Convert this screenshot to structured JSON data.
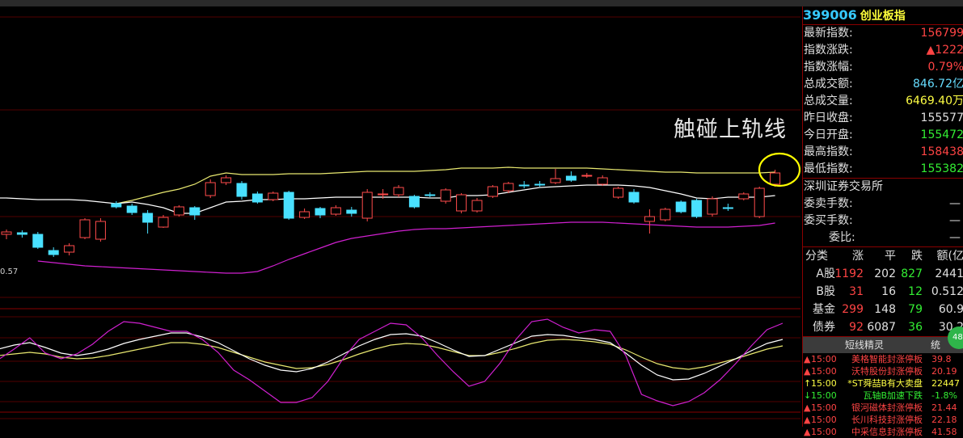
{
  "annotation": "触碰上轨线",
  "y_axis_label": "0.57",
  "stock": {
    "code": "399006",
    "name": "创业板指"
  },
  "quote_rows": [
    {
      "label": "最新指数:",
      "value": "156799",
      "color": "#ff4444"
    },
    {
      "label": "指数涨跌:",
      "value": "▲1222",
      "color": "#ff4444"
    },
    {
      "label": "指数涨幅:",
      "value": "0.79%",
      "color": "#ff4444"
    },
    {
      "label": "总成交额:",
      "value": "846.72亿",
      "color": "#66ddff"
    },
    {
      "label": "总成交量:",
      "value": "6469.40万",
      "color": "#ffff44"
    },
    {
      "label": "昨日收盘:",
      "value": "155577",
      "color": "#e0e0e0"
    },
    {
      "label": "今日开盘:",
      "value": "155472",
      "color": "#33ee33"
    },
    {
      "label": "最高指数:",
      "value": "158438",
      "color": "#ff4444"
    },
    {
      "label": "最低指数:",
      "value": "155382",
      "color": "#33ee33"
    }
  ],
  "exchange": "深圳证券交易所",
  "order_rows": [
    {
      "label": "委卖手数:",
      "value": "—"
    },
    {
      "label": "委买手数:",
      "value": "—"
    },
    {
      "label": "委比:",
      "value": "—"
    }
  ],
  "breadth": {
    "headers": [
      "分类",
      "涨",
      "平",
      "跌",
      "额(亿"
    ],
    "rows": [
      {
        "cat": "A股",
        "up": "1192",
        "flat": "202",
        "down": "827",
        "amt": "2441"
      },
      {
        "cat": "B股",
        "up": "31",
        "flat": "16",
        "down": "12",
        "amt": "0.512"
      },
      {
        "cat": "基金",
        "up": "299",
        "flat": "148",
        "down": "79",
        "amt": "60.9"
      },
      {
        "cat": "债券",
        "up": "92",
        "flat": "6087",
        "down": "36",
        "amt": "30.2"
      }
    ]
  },
  "sprite": {
    "title": "短线精灵",
    "tab2": "统",
    "badge": "48"
  },
  "alerts": [
    {
      "arrow": "▲",
      "time": "15:00",
      "name": "美格智能",
      "event": "封涨停板",
      "value": "39.8",
      "color": "#ff4444"
    },
    {
      "arrow": "▲",
      "time": "15:00",
      "name": "沃特股份",
      "event": "封涨停板",
      "value": "20.19",
      "color": "#ff4444"
    },
    {
      "arrow": "↑",
      "time": "15:00",
      "name": "*ST舜喆B",
      "event": "有大卖盘",
      "value": "22447",
      "color": "#ffff44"
    },
    {
      "arrow": "↓",
      "time": "15:00",
      "name": "瓦轴B",
      "event": "加速下跌",
      "value": "-1.8%",
      "color": "#33ee33"
    },
    {
      "arrow": "▲",
      "time": "15:00",
      "name": "银河磁体",
      "event": "封涨停板",
      "value": "21.44",
      "color": "#ff4444"
    },
    {
      "arrow": "▲",
      "time": "15:00",
      "name": "长川科技",
      "event": "封涨停板",
      "value": "22.18",
      "color": "#ff4444"
    },
    {
      "arrow": "▲",
      "time": "15:00",
      "name": "中采信息",
      "event": "封涨停板",
      "value": "41.58",
      "color": "#ff4444"
    }
  ],
  "chart_data": {
    "type": "candlestick",
    "candles": [
      {
        "o": 290,
        "c": 287,
        "h": 284,
        "l": 296
      },
      {
        "o": 288,
        "c": 290,
        "h": 285,
        "l": 294
      },
      {
        "o": 290,
        "c": 306,
        "h": 287,
        "l": 308
      },
      {
        "o": 310,
        "c": 315,
        "h": 306,
        "l": 318
      },
      {
        "o": 312,
        "c": 304,
        "h": 301,
        "l": 316
      },
      {
        "o": 294,
        "c": 272,
        "h": 270,
        "l": 296
      },
      {
        "o": 296,
        "c": 274,
        "h": 270,
        "l": 299
      },
      {
        "o": 252,
        "c": 256,
        "h": 249,
        "l": 258
      },
      {
        "o": 255,
        "c": 263,
        "h": 252,
        "l": 266
      },
      {
        "o": 264,
        "c": 275,
        "h": 260,
        "l": 289
      },
      {
        "o": 281,
        "c": 269,
        "h": 266,
        "l": 282
      },
      {
        "o": 266,
        "c": 256,
        "h": 254,
        "l": 268
      },
      {
        "o": 257,
        "c": 266,
        "h": 255,
        "l": 272
      },
      {
        "o": 242,
        "c": 226,
        "h": 222,
        "l": 245
      },
      {
        "o": 226,
        "c": 220,
        "h": 217,
        "l": 229
      },
      {
        "o": 227,
        "c": 243,
        "h": 224,
        "l": 247
      },
      {
        "o": 240,
        "c": 250,
        "h": 237,
        "l": 252
      },
      {
        "o": 247,
        "c": 239,
        "h": 237,
        "l": 249
      },
      {
        "o": 238,
        "c": 270,
        "h": 236,
        "l": 272
      },
      {
        "o": 269,
        "c": 262,
        "h": 258,
        "l": 271
      },
      {
        "o": 258,
        "c": 266,
        "h": 256,
        "l": 270
      },
      {
        "o": 265,
        "c": 257,
        "h": 254,
        "l": 267
      },
      {
        "o": 260,
        "c": 264,
        "h": 256,
        "l": 268
      },
      {
        "o": 270,
        "c": 238,
        "h": 234,
        "l": 274
      },
      {
        "o": 241,
        "c": 240,
        "h": 234,
        "l": 246
      },
      {
        "o": 241,
        "c": 232,
        "h": 229,
        "l": 244
      },
      {
        "o": 243,
        "c": 256,
        "h": 241,
        "l": 258
      },
      {
        "o": 241,
        "c": 241,
        "h": 238,
        "l": 244
      },
      {
        "o": 249,
        "c": 235,
        "h": 233,
        "l": 252
      },
      {
        "o": 261,
        "c": 241,
        "h": 239,
        "l": 264
      },
      {
        "o": 261,
        "c": 248,
        "h": 245,
        "l": 263
      },
      {
        "o": 243,
        "c": 231,
        "h": 229,
        "l": 245
      },
      {
        "o": 236,
        "c": 227,
        "h": 225,
        "l": 239
      },
      {
        "o": 229,
        "c": 229,
        "h": 224,
        "l": 233
      },
      {
        "o": 228,
        "c": 228,
        "h": 224,
        "l": 231
      },
      {
        "o": 226,
        "c": 221,
        "h": 209,
        "l": 228
      },
      {
        "o": 218,
        "c": 223,
        "h": 212,
        "l": 225
      },
      {
        "o": 218,
        "c": 217,
        "h": 214,
        "l": 220
      },
      {
        "o": 228,
        "c": 220,
        "h": 217,
        "l": 230
      },
      {
        "o": 244,
        "c": 233,
        "h": 231,
        "l": 246
      },
      {
        "o": 238,
        "c": 250,
        "h": 234,
        "l": 252
      },
      {
        "o": 274,
        "c": 268,
        "h": 259,
        "l": 289
      },
      {
        "o": 272,
        "c": 259,
        "h": 257,
        "l": 274
      },
      {
        "o": 250,
        "c": 262,
        "h": 248,
        "l": 264
      },
      {
        "o": 248,
        "c": 268,
        "h": 246,
        "l": 270
      },
      {
        "o": 265,
        "c": 246,
        "h": 243,
        "l": 268
      },
      {
        "o": 257,
        "c": 257,
        "h": 252,
        "l": 261
      },
      {
        "o": 246,
        "c": 240,
        "h": 238,
        "l": 248
      },
      {
        "o": 268,
        "c": 233,
        "h": 231,
        "l": 270
      },
      {
        "o": 228,
        "c": 214,
        "h": 210,
        "l": 231
      }
    ],
    "bollinger": {
      "upper": [
        null,
        null,
        null,
        null,
        null,
        null,
        null,
        252,
        248,
        243,
        238,
        234,
        228,
        218,
        214,
        216,
        216,
        216,
        215,
        215,
        215,
        214,
        213,
        212,
        212,
        212,
        212,
        211,
        210,
        208,
        208,
        208,
        207,
        208,
        208,
        208,
        208,
        208,
        209,
        210,
        211,
        212,
        213,
        213,
        214,
        214,
        214,
        214,
        214,
        213
      ],
      "middle": [
        245,
        246,
        247,
        247,
        247,
        248,
        250,
        252,
        250,
        253,
        257,
        264,
        264,
        257,
        250,
        249,
        247,
        247,
        246,
        246,
        245,
        244,
        244,
        244,
        244,
        244,
        244,
        245,
        245,
        242,
        242,
        241,
        238,
        235,
        232,
        231,
        230,
        229,
        229,
        229,
        230,
        232,
        236,
        240,
        245,
        246,
        244,
        244,
        244,
        242
      ],
      "lower": [
        null,
        null,
        323,
        325,
        327,
        329,
        330,
        331,
        332,
        333,
        334,
        335,
        336,
        337,
        338,
        338,
        336,
        329,
        321,
        314,
        307,
        300,
        295,
        292,
        289,
        286,
        284,
        283,
        283,
        282,
        281,
        280,
        279,
        278,
        277,
        276,
        275,
        275,
        275,
        276,
        277,
        278,
        279,
        280,
        281,
        281,
        281,
        280,
        279,
        276
      ]
    },
    "oscillator": {
      "magenta": [
        445,
        432,
        418,
        437,
        444,
        438,
        426,
        410,
        398,
        400,
        405,
        410,
        410,
        420,
        436,
        458,
        470,
        484,
        498,
        498,
        492,
        472,
        443,
        420,
        410,
        400,
        402,
        418,
        440,
        460,
        478,
        472,
        449,
        420,
        398,
        395,
        405,
        412,
        408,
        410,
        440,
        488,
        496,
        502,
        497,
        486,
        470,
        450,
        428,
        408,
        400
      ],
      "white": [
        432,
        427,
        424,
        430,
        437,
        440,
        437,
        432,
        425,
        420,
        416,
        412,
        412,
        417,
        424,
        434,
        444,
        452,
        458,
        460,
        456,
        448,
        438,
        428,
        420,
        414,
        413,
        416,
        424,
        433,
        441,
        440,
        432,
        424,
        416,
        414,
        415,
        418,
        420,
        424,
        437,
        452,
        464,
        470,
        469,
        462,
        453,
        444,
        434,
        425,
        420
      ],
      "yellow": [
        440,
        438,
        436,
        438,
        442,
        444,
        443,
        440,
        436,
        432,
        428,
        424,
        424,
        426,
        430,
        436,
        442,
        448,
        452,
        456,
        455,
        451,
        445,
        438,
        432,
        427,
        425,
        426,
        430,
        435,
        440,
        440,
        436,
        431,
        425,
        421,
        420,
        421,
        423,
        426,
        433,
        442,
        450,
        455,
        457,
        454,
        449,
        444,
        438,
        432,
        428
      ]
    }
  }
}
